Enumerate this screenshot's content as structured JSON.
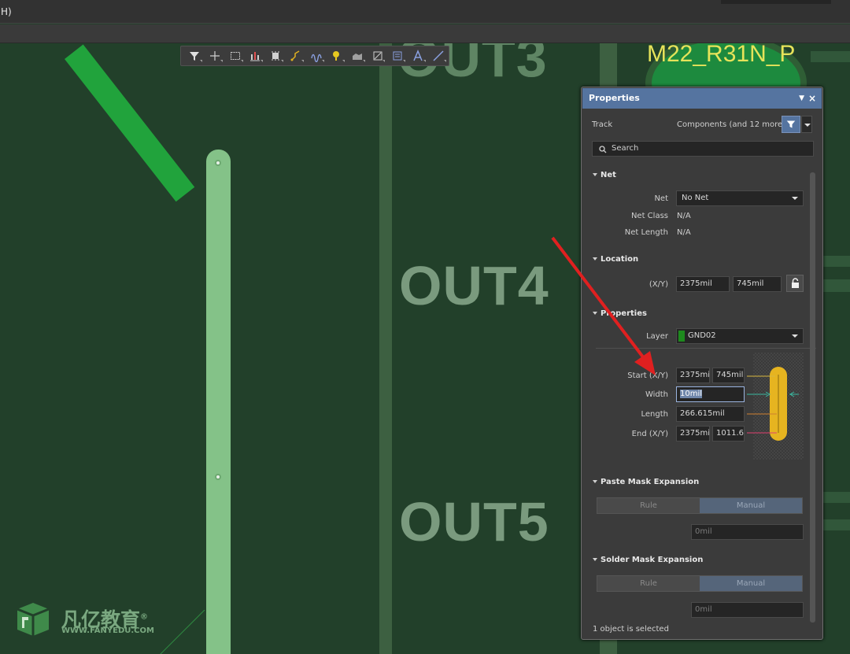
{
  "menubar": {
    "menu_fragment": "H)"
  },
  "canvas": {
    "silkscreen_top": "OUT3",
    "silkscreen_mid": "OUT4",
    "silkscreen_bot": "OUT5",
    "pad_label": "M22_R31N_P"
  },
  "place_toolbar": {
    "items": [
      {
        "icon": "filter-icon"
      },
      {
        "icon": "crosshair-icon"
      },
      {
        "icon": "select-rect-icon"
      },
      {
        "icon": "align-icon"
      },
      {
        "icon": "component-icon"
      },
      {
        "icon": "route-icon"
      },
      {
        "icon": "tune-icon"
      },
      {
        "icon": "pin-icon"
      },
      {
        "icon": "polygon-icon"
      },
      {
        "icon": "dimension-icon"
      },
      {
        "icon": "keepout-icon"
      },
      {
        "icon": "text-icon"
      },
      {
        "icon": "line-icon"
      }
    ]
  },
  "logo": {
    "chinese": "凡亿教育",
    "mark": "®",
    "url": "WWW.FANYEDU.COM"
  },
  "panel": {
    "title": "Properties",
    "menu_glyph": "▼",
    "close_glyph": "×",
    "object_type": "Track",
    "filter_text": "Components (and 12 more)",
    "search_placeholder": "Search",
    "net": {
      "header": "Net",
      "net_label": "Net",
      "net_value": "No Net",
      "class_label": "Net Class",
      "class_value": "N/A",
      "length_label": "Net Length",
      "length_value": "N/A"
    },
    "location": {
      "header": "Location",
      "xy_label": "(X/Y)",
      "x_value": "2375mil",
      "y_value": "745mil"
    },
    "properties": {
      "header": "Properties",
      "layer_label": "Layer",
      "layer_value": "GND02",
      "layer_color": "#1d8a1d",
      "start_label": "Start (X/Y)",
      "start_x": "2375mi",
      "start_y": "745mil",
      "width_label": "Width",
      "width_value": "10mil",
      "length_label": "Length",
      "length_value": "266.615mil",
      "end_label": "End (X/Y)",
      "end_x": "2375mi",
      "end_y": "1011.6:"
    },
    "paste_mask": {
      "header": "Paste Mask Expansion",
      "rule_label": "Rule",
      "manual_label": "Manual",
      "value": "0mil"
    },
    "solder_mask": {
      "header": "Solder Mask Expansion",
      "rule_label": "Rule",
      "manual_label": "Manual",
      "value": "0mil"
    },
    "status": "1 object is selected"
  },
  "colors": {
    "board_bg": "#22402a",
    "track": "#84c288",
    "panel_title": "#5574a0",
    "annotation_arrow": "#e02020",
    "diagram_track": "#e6b420"
  }
}
